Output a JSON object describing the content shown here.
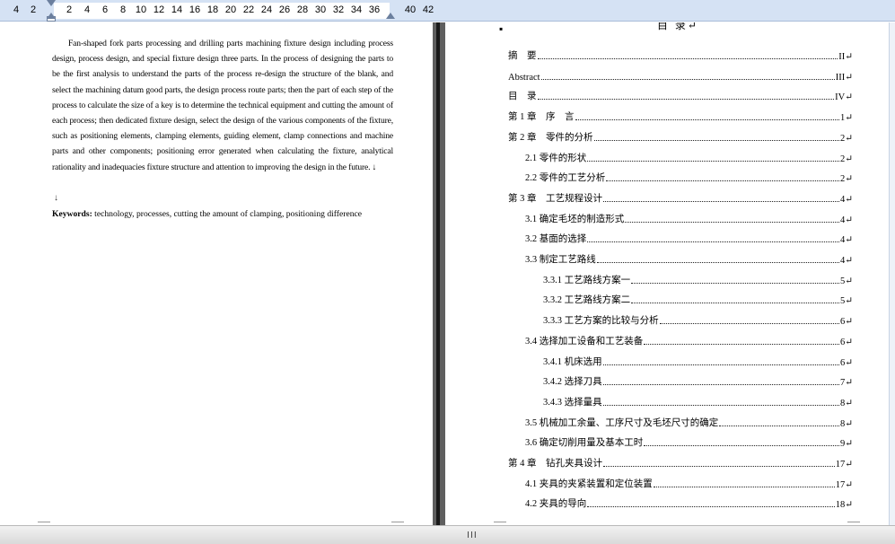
{
  "ruler": {
    "ticks": [
      "4",
      "2",
      "2",
      "4",
      "6",
      "8",
      "10",
      "12",
      "14",
      "16",
      "18",
      "20",
      "22",
      "24",
      "26",
      "28",
      "30",
      "32",
      "34",
      "36",
      "40",
      "42"
    ]
  },
  "left_page": {
    "abstract": "Fan-shaped fork parts processing and drilling parts machining fixture design including process design, process design, and special fixture design three parts. In the process of designing the parts to be the first analysis to understand the parts of the process re-design the structure of the blank, and select the machining datum good parts, the design process route parts; then the part of each step of the process to calculate the size of a key is to determine the technical equipment and cutting the amount of each process; then dedicated fixture design, select the design of the various components of the fixture, such as positioning elements, clamping elements, guiding element, clamp connections and machine parts and other components; positioning error generated when calculating the fixture, analytical rationality and inadequacies fixture structure and attention to improving the design in the future. ↓",
    "return_mark": "↓",
    "keywords_label": "Keywords:",
    "keywords_text": " technology, processes, cutting the amount of clamping, positioning difference"
  },
  "right_page": {
    "bullet": "▪",
    "toc_title": "目 录↵",
    "toc": [
      {
        "label": "摘　要",
        "page": "II↵",
        "level": 1
      },
      {
        "label": "Abstract",
        "page": "III↵",
        "level": 1
      },
      {
        "label": "目　录",
        "page": "IV↵",
        "level": 1
      },
      {
        "label": "第 1 章　序　言",
        "page": "1↵",
        "level": 1
      },
      {
        "label": "第 2 章　零件的分析",
        "page": "2↵",
        "level": 1
      },
      {
        "label": "2.1 零件的形状",
        "page": "2↵",
        "level": 2
      },
      {
        "label": "2.2 零件的工艺分析",
        "page": "2↵",
        "level": 2
      },
      {
        "label": "第 3 章　工艺规程设计",
        "page": "4↵",
        "level": 1
      },
      {
        "label": "3.1  确定毛坯的制造形式",
        "page": "4↵",
        "level": 2
      },
      {
        "label": "3.2  基面的选择",
        "page": "4↵",
        "level": 2
      },
      {
        "label": "3.3  制定工艺路线",
        "page": "4↵",
        "level": 2
      },
      {
        "label": "3.3.1  工艺路线方案一",
        "page": "5↵",
        "level": 3
      },
      {
        "label": "3.3.2  工艺路线方案二",
        "page": "5↵",
        "level": 3
      },
      {
        "label": "3.3.3  工艺方案的比较与分析",
        "page": "6↵",
        "level": 3
      },
      {
        "label": "3.4  选择加工设备和工艺装备",
        "page": "6↵",
        "level": 2
      },
      {
        "label": "3.4.1  机床选用",
        "page": "6↵",
        "level": 3
      },
      {
        "label": "3.4.2  选择刀具",
        "page": "7↵",
        "level": 3
      },
      {
        "label": "3.4.3  选择量具",
        "page": "8↵",
        "level": 3
      },
      {
        "label": "3.5  机械加工余量、工序尺寸及毛坯尺寸的确定",
        "page": "8↵",
        "level": 2
      },
      {
        "label": "3.6 确定切削用量及基本工时",
        "page": "9↵",
        "level": 2
      },
      {
        "label": "第 4 章　钻孔夹具设计",
        "page": "17↵",
        "level": 1
      },
      {
        "label": "4.1  夹具的夹紧装置和定位装置",
        "page": "17↵",
        "level": 2
      },
      {
        "label": "4.2  夹具的导向",
        "page": "18↵",
        "level": 2
      }
    ]
  },
  "scrollbar": {
    "grip": "III"
  }
}
